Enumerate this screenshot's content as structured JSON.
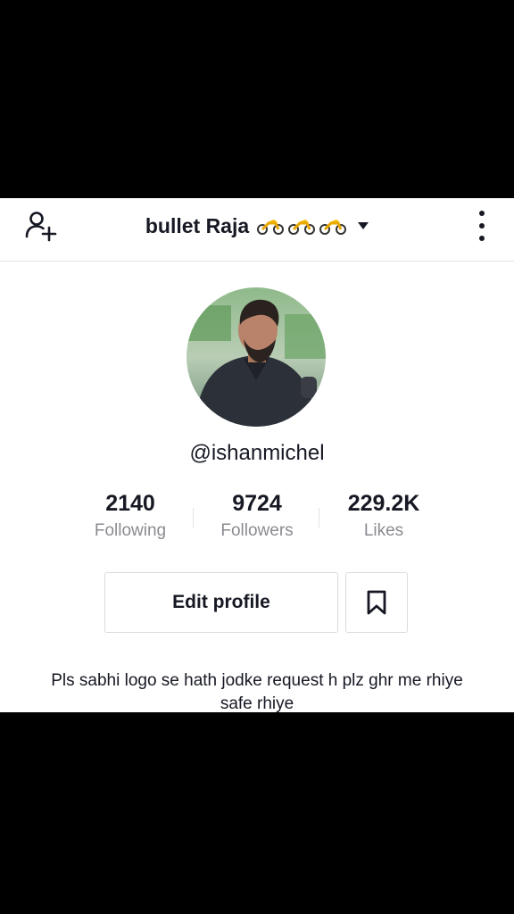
{
  "header": {
    "title": "bullet Raja",
    "title_emoji_icons": [
      "motorcycle-icon",
      "motorcycle-icon",
      "motorcycle-icon"
    ],
    "add_user_icon": "add-user-icon",
    "more_icon": "vertical-dots-icon"
  },
  "profile": {
    "handle": "@ishanmichel",
    "avatar_icon": "avatar-photo"
  },
  "stats": [
    {
      "value": "2140",
      "label": "Following"
    },
    {
      "value": "9724",
      "label": "Followers"
    },
    {
      "value": "229.2K",
      "label": "Likes"
    }
  ],
  "actions": {
    "edit_profile_label": "Edit profile",
    "bookmark_icon": "bookmark-icon"
  },
  "bio": "Pls sabhi logo se hath jodke request h plz ghr me rhiye safe rhiye",
  "colors": {
    "text_primary": "#161823",
    "text_secondary": "#8a8b91",
    "border": "#dcdcdc",
    "background": "#ffffff",
    "outer_background": "#000000"
  }
}
